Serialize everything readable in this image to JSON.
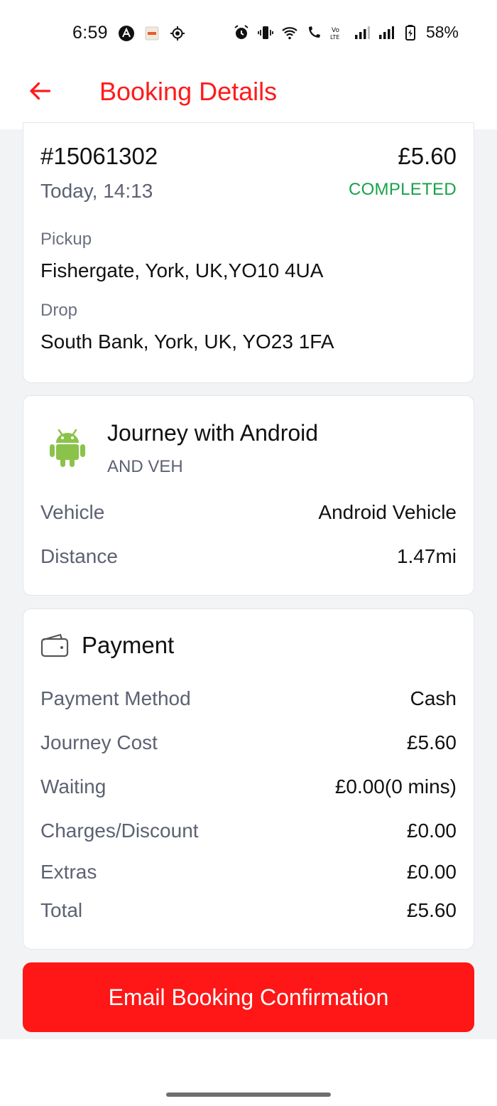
{
  "status_bar": {
    "time": "6:59",
    "battery": "58%",
    "left_icons": [
      "a-icon",
      "app-icon",
      "location-icon"
    ],
    "right_icons": [
      "alarm-icon",
      "vibrate-icon",
      "wifi-icon",
      "wifi-call-icon",
      "volte-icon",
      "signal-icon",
      "signal-icon",
      "battery-icon"
    ]
  },
  "header": {
    "title": "Booking Details",
    "back_icon": "arrow-left-icon",
    "accent_color": "#ff1a1a"
  },
  "booking": {
    "id": "#15061302",
    "date": "Today, 14:13",
    "price": "£5.60",
    "status": "COMPLETED",
    "status_color": "#19a14a",
    "pickup_label": "Pickup",
    "pickup_address": "Fishergate, York, UK,YO10 4UA",
    "drop_label": "Drop",
    "drop_address": "South Bank, York, UK, YO23 1FA"
  },
  "journey": {
    "icon": "android-icon",
    "title": "Journey with Android",
    "subtitle": "AND VEH",
    "rows": [
      {
        "label": "Vehicle",
        "value": "Android Vehicle"
      },
      {
        "label": "Distance",
        "value": "1.47mi"
      }
    ]
  },
  "payment": {
    "icon": "wallet-icon",
    "title": "Payment",
    "rows": [
      {
        "label": "Payment Method",
        "value": "Cash"
      },
      {
        "label": "Journey Cost",
        "value": "£5.60"
      },
      {
        "label": "Waiting",
        "value": "£0.00(0 mins)"
      },
      {
        "label": "Charges/Discount",
        "value": "£0.00"
      },
      {
        "label": "Extras",
        "value": "£0.00"
      },
      {
        "label": "Total",
        "value": "£5.60"
      }
    ]
  },
  "actions": {
    "email_button_label": "Email Booking Confirmation"
  }
}
